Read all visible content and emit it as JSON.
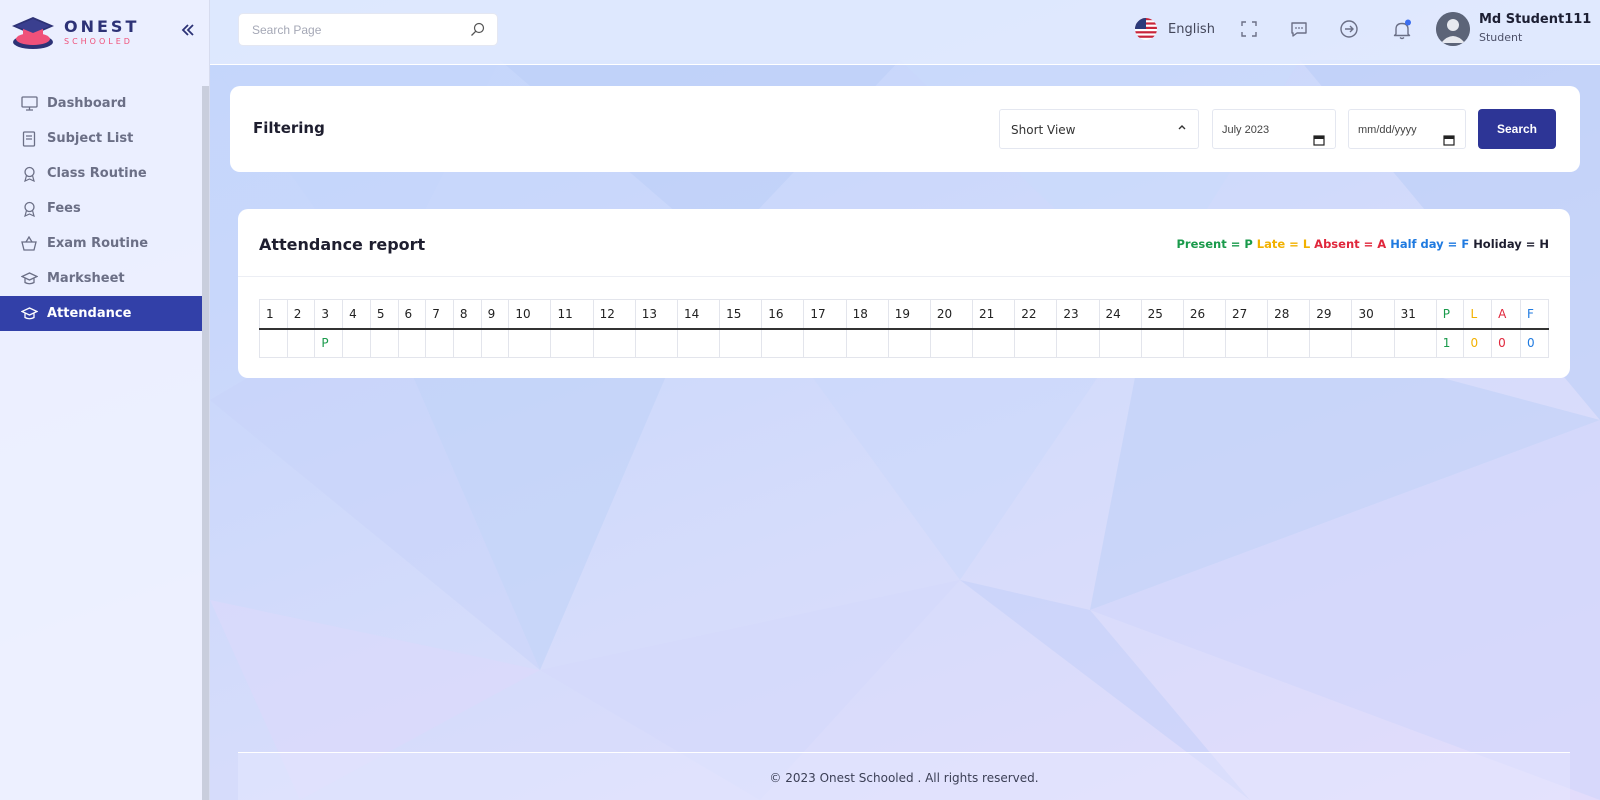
{
  "brand": {
    "name": "ONEST",
    "sub": "SCHOOLED"
  },
  "sidebar": {
    "items": [
      {
        "label": "Dashboard",
        "icon": "monitor-icon",
        "active": false
      },
      {
        "label": "Subject List",
        "icon": "book-icon",
        "active": false
      },
      {
        "label": "Class Routine",
        "icon": "award-icon",
        "active": false
      },
      {
        "label": "Fees",
        "icon": "award-icon",
        "active": false
      },
      {
        "label": "Exam Routine",
        "icon": "basket-icon",
        "active": false
      },
      {
        "label": "Marksheet",
        "icon": "graduation-cap-icon",
        "active": false
      },
      {
        "label": "Attendance",
        "icon": "graduation-cap-icon",
        "active": true
      }
    ]
  },
  "topbar": {
    "search_placeholder": "Search Page",
    "language": "English",
    "user_name": "Md Student111",
    "user_role": "Student"
  },
  "filter": {
    "title": "Filtering",
    "view_select": "Short View",
    "month_value": "July 2023",
    "date_placeholder": "mm/dd/yyyy",
    "search_label": "Search"
  },
  "attendance": {
    "title": "Attendance report",
    "legend": [
      {
        "text": "Present = P",
        "color": "#1a9a4b"
      },
      {
        "text": "Late = L",
        "color": "#f2b100"
      },
      {
        "text": "Absent = A",
        "color": "#e0263b"
      },
      {
        "text": "Half day = F",
        "color": "#1f7ae0"
      },
      {
        "text": "Holiday = H",
        "color": "#1e1e2f"
      }
    ],
    "days": [
      "1",
      "2",
      "3",
      "4",
      "5",
      "6",
      "7",
      "8",
      "9",
      "10",
      "11",
      "12",
      "13",
      "14",
      "15",
      "16",
      "17",
      "18",
      "19",
      "20",
      "21",
      "22",
      "23",
      "24",
      "25",
      "26",
      "27",
      "28",
      "29",
      "30",
      "31"
    ],
    "summary_headers": [
      {
        "text": "P",
        "color": "#1a9a4b"
      },
      {
        "text": "L",
        "color": "#f2b100"
      },
      {
        "text": "A",
        "color": "#e0263b"
      },
      {
        "text": "F",
        "color": "#1f7ae0"
      }
    ],
    "marks": [
      "",
      "",
      "P",
      "",
      "",
      "",
      "",
      "",
      "",
      "",
      "",
      "",
      "",
      "",
      "",
      "",
      "",
      "",
      "",
      "",
      "",
      "",
      "",
      "",
      "",
      "",
      "",
      "",
      "",
      "",
      ""
    ],
    "summary_values": [
      "1",
      "0",
      "0",
      "0"
    ]
  },
  "footer": {
    "text": "© 2023 Onest Schooled . All rights reserved."
  },
  "colors": {
    "primary": "#2d3596",
    "active_nav": "#3240a8",
    "brand_pink": "#f0517a"
  }
}
